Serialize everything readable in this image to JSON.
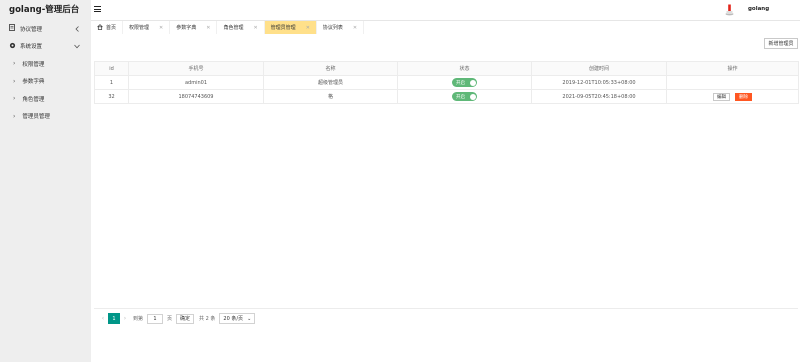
{
  "app": {
    "title": "golang-管理后台"
  },
  "sidebar": {
    "items": [
      {
        "label": "协议管理",
        "icon": "document-icon",
        "arrow": "‹"
      },
      {
        "label": "系统设置",
        "icon": "gear-icon",
        "arrow": "⌄"
      }
    ],
    "sub_items": [
      {
        "label": "权限管理"
      },
      {
        "label": "参数字典"
      },
      {
        "label": "角色管理"
      },
      {
        "label": "管理员管理"
      }
    ]
  },
  "header": {
    "username": "golang"
  },
  "tabs": [
    {
      "label": "首页",
      "closable": false,
      "active": false
    },
    {
      "label": "权限管理",
      "closable": true,
      "active": false
    },
    {
      "label": "参数字典",
      "closable": true,
      "active": false
    },
    {
      "label": "角色管理",
      "closable": true,
      "active": false
    },
    {
      "label": "管理员管理",
      "closable": true,
      "active": true
    },
    {
      "label": "协议列表",
      "closable": true,
      "active": false
    }
  ],
  "toolbar": {
    "add_label": "新增管理员"
  },
  "table": {
    "columns": [
      "id",
      "手机号",
      "名称",
      "状态",
      "创建时间",
      "操作"
    ],
    "rows": [
      {
        "id": "1",
        "phone": "admin01",
        "name": "超级管理员",
        "status": "开启",
        "created": "2019-12-01T10:05:33+08:00",
        "actions": []
      },
      {
        "id": "32",
        "phone": "18074743609",
        "name": "格",
        "status": "开启",
        "created": "2021-09-05T20:45:18+08:00",
        "actions": [
          "编辑",
          "删除"
        ]
      }
    ]
  },
  "pagination": {
    "current": "1",
    "goto_label": "到第",
    "goto_value": "1",
    "page_suffix": "页",
    "confirm_label": "确定",
    "total_label": "共 2 条",
    "page_size": "20 条/页"
  },
  "colors": {
    "accent": "#009688",
    "switch_on": "#5fb878",
    "active_tab": "#ffe08a",
    "danger": "#ff5722"
  }
}
